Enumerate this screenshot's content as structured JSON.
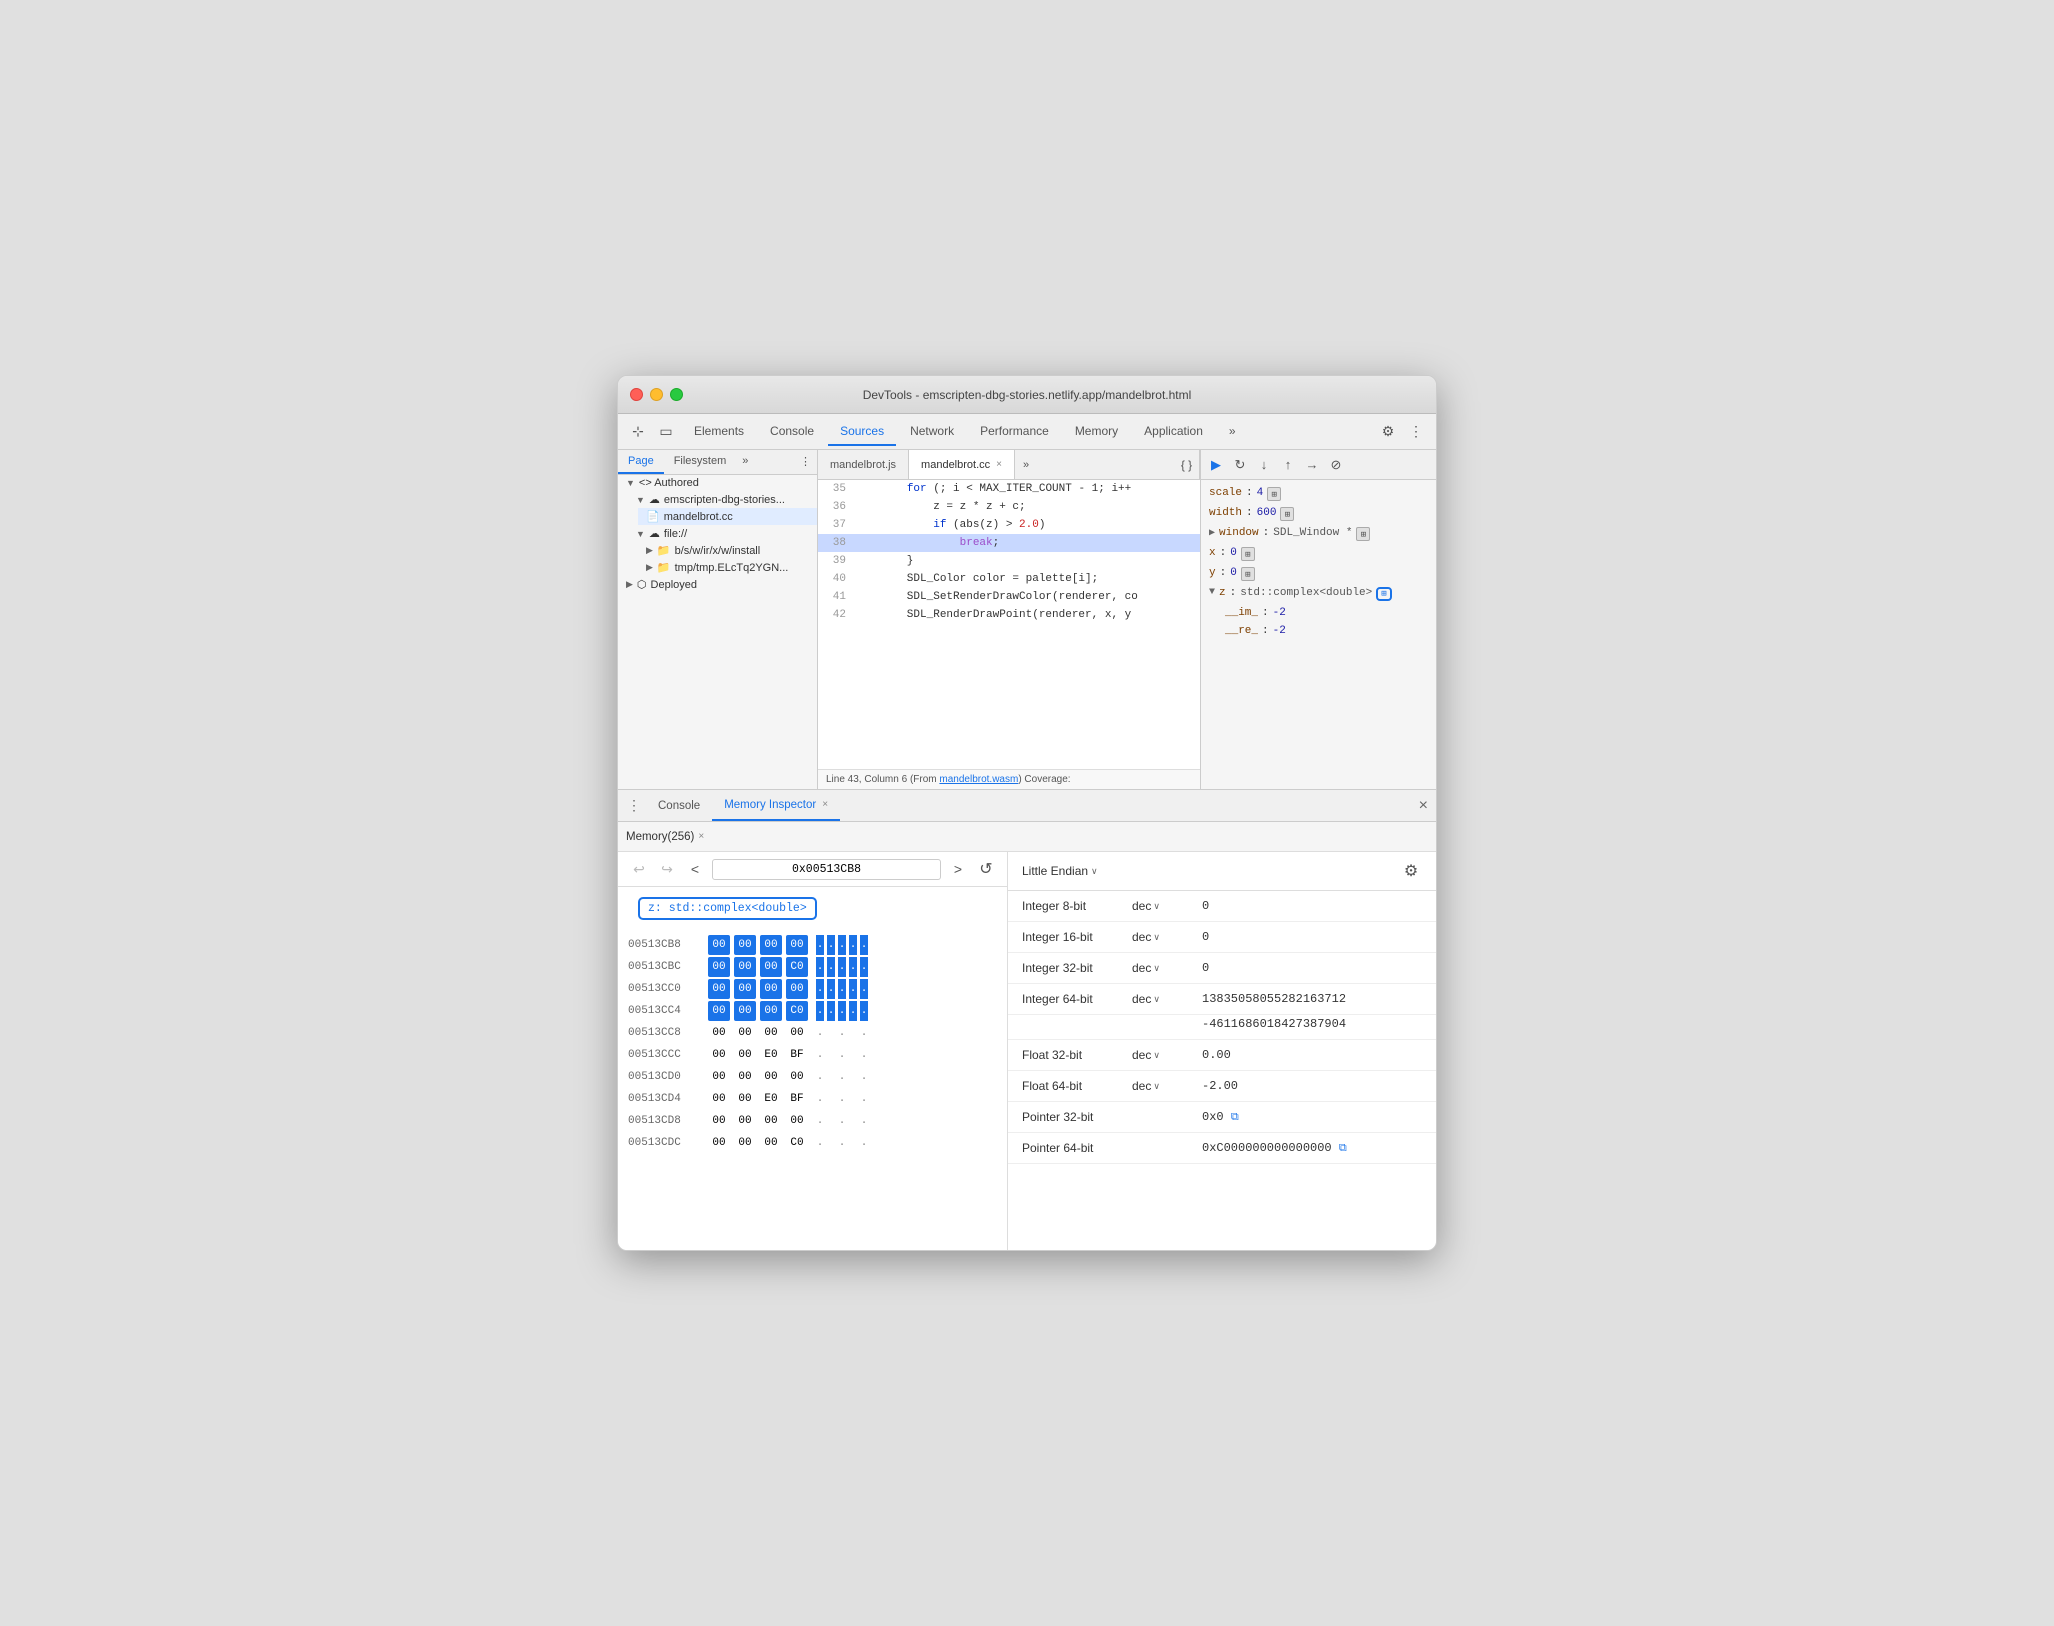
{
  "window": {
    "title": "DevTools - emscripten-dbg-stories.netlify.app/mandelbrot.html"
  },
  "toolbar": {
    "tabs": [
      {
        "label": "Elements",
        "active": false
      },
      {
        "label": "Console",
        "active": false
      },
      {
        "label": "Sources",
        "active": true
      },
      {
        "label": "Network",
        "active": false
      },
      {
        "label": "Performance",
        "active": false
      },
      {
        "label": "Memory",
        "active": false
      },
      {
        "label": "Application",
        "active": false
      },
      {
        "label": "»",
        "active": false
      }
    ]
  },
  "left_panel": {
    "tabs": [
      "Page",
      "Filesystem",
      "»"
    ],
    "tree": [
      {
        "label": "Authored",
        "level": 0,
        "type": "group"
      },
      {
        "label": "emscripten-dbg-stories...",
        "level": 1,
        "type": "cloud"
      },
      {
        "label": "mandelbrot.cc",
        "level": 2,
        "type": "file",
        "selected": true
      },
      {
        "label": "file://",
        "level": 1,
        "type": "cloud"
      },
      {
        "label": "b/s/w/ir/x/w/install",
        "level": 2,
        "type": "folder"
      },
      {
        "label": "tmp/tmp.ELcTq2YGN...",
        "level": 2,
        "type": "folder"
      },
      {
        "label": "Deployed",
        "level": 0,
        "type": "group"
      }
    ]
  },
  "code_panel": {
    "tabs": [
      "mandelbrot.js",
      "mandelbrot.cc"
    ],
    "active_tab": "mandelbrot.cc",
    "lines": [
      {
        "num": 35,
        "content": "        for (; i < MAX_ITER_COUNT - 1; i++",
        "highlighted": false
      },
      {
        "num": 36,
        "content": "            z = z * z + c;",
        "highlighted": false
      },
      {
        "num": 37,
        "content": "            if (abs(z) > 2.0)",
        "highlighted": false
      },
      {
        "num": 38,
        "content": "                break;",
        "highlighted": true
      },
      {
        "num": 39,
        "content": "        }",
        "highlighted": false
      },
      {
        "num": 40,
        "content": "        SDL_Color color = palette[i];",
        "highlighted": false
      },
      {
        "num": 41,
        "content": "        SDL_SetRenderDrawColor(renderer, co",
        "highlighted": false
      },
      {
        "num": 42,
        "content": "        SDL_RenderDrawPoint(renderer, x, y",
        "highlighted": false
      }
    ],
    "status": "Line 43, Column 6 (From mandelbrot.wasm) Coverage:"
  },
  "right_panel": {
    "scope_items": [
      {
        "key": "scale",
        "value": "4",
        "chip": true
      },
      {
        "key": "width",
        "value": "600",
        "chip": true
      },
      {
        "key": "window",
        "value": "SDL_Window *",
        "chip": true,
        "expandable": true
      },
      {
        "key": "x",
        "value": "0",
        "chip": true
      },
      {
        "key": "y",
        "value": "0",
        "chip": true
      },
      {
        "key": "z",
        "value": "std::complex<double>",
        "chip": true,
        "expandable": true,
        "highlighted": true
      },
      {
        "key": "__im_",
        "value": "-2",
        "indent": true
      },
      {
        "key": "__re_",
        "value": "-2",
        "indent": true
      }
    ]
  },
  "bottom_panel": {
    "tabs": [
      "Console",
      "Memory Inspector"
    ],
    "active_tab": "Memory Inspector",
    "memory_tabs": [
      "Memory(256)"
    ],
    "active_memory_tab": "Memory(256)"
  },
  "memory_viewer": {
    "address": "0x00513CB8",
    "variable_label": "z: std::complex<double>",
    "rows": [
      {
        "addr": "00513CB8",
        "bytes": [
          "00",
          "00",
          "00",
          "00"
        ],
        "ascii": [
          ".",
          ".",
          ".",
          ".",
          "."
        ],
        "highlighted": [
          true,
          true,
          true,
          true
        ]
      },
      {
        "addr": "00513CBC",
        "bytes": [
          "00",
          "00",
          "00",
          "C0"
        ],
        "ascii": [
          ".",
          ".",
          ".",
          ".",
          "."
        ],
        "highlighted": [
          true,
          true,
          true,
          true
        ]
      },
      {
        "addr": "00513CC0",
        "bytes": [
          "00",
          "00",
          "00",
          "00"
        ],
        "ascii": [
          ".",
          ".",
          ".",
          ".",
          "."
        ],
        "highlighted": [
          true,
          true,
          true,
          true
        ]
      },
      {
        "addr": "00513CC4",
        "bytes": [
          "00",
          "00",
          "00",
          "C0"
        ],
        "ascii": [
          ".",
          ".",
          ".",
          ".",
          "."
        ],
        "highlighted": [
          true,
          true,
          true,
          true
        ]
      },
      {
        "addr": "00513CC8",
        "bytes": [
          "00",
          "00",
          "00",
          "00"
        ],
        "ascii": [
          ".",
          ".",
          " ",
          ".",
          " "
        ],
        "highlighted": [
          false,
          false,
          false,
          false
        ]
      },
      {
        "addr": "00513CCC",
        "bytes": [
          "00",
          "00",
          "E0",
          "BF"
        ],
        "ascii": [
          ".",
          ".",
          " ",
          ".",
          " "
        ],
        "highlighted": [
          false,
          false,
          false,
          false
        ]
      },
      {
        "addr": "00513CD0",
        "bytes": [
          "00",
          "00",
          "00",
          "00"
        ],
        "ascii": [
          ".",
          ".",
          " ",
          ".",
          " "
        ],
        "highlighted": [
          false,
          false,
          false,
          false
        ]
      },
      {
        "addr": "00513CD4",
        "bytes": [
          "00",
          "00",
          "E0",
          "BF"
        ],
        "ascii": [
          ".",
          ".",
          " ",
          ".",
          " "
        ],
        "highlighted": [
          false,
          false,
          false,
          false
        ]
      },
      {
        "addr": "00513CD8",
        "bytes": [
          "00",
          "00",
          "00",
          "00"
        ],
        "ascii": [
          ".",
          ".",
          " ",
          ".",
          " "
        ],
        "highlighted": [
          false,
          false,
          false,
          false
        ]
      },
      {
        "addr": "00513CDC",
        "bytes": [
          "00",
          "00",
          "00",
          "C0"
        ],
        "ascii": [
          ".",
          ".",
          " ",
          ".",
          " "
        ],
        "highlighted": [
          false,
          false,
          false,
          false
        ]
      }
    ]
  },
  "memory_inspector": {
    "endian": "Little Endian",
    "rows": [
      {
        "label": "Integer 8-bit",
        "format": "dec",
        "value": "0"
      },
      {
        "label": "Integer 16-bit",
        "format": "dec",
        "value": "0"
      },
      {
        "label": "Integer 32-bit",
        "format": "dec",
        "value": "0"
      },
      {
        "label": "Integer 64-bit",
        "format": "dec",
        "value": "13835058055282163712",
        "extra": "-4611686018427387904"
      },
      {
        "label": "Float 32-bit",
        "format": "dec",
        "value": "0.00"
      },
      {
        "label": "Float 64-bit",
        "format": "dec",
        "value": "-2.00"
      },
      {
        "label": "Pointer 32-bit",
        "format": null,
        "value": "0x0",
        "link": true
      },
      {
        "label": "Pointer 64-bit",
        "format": null,
        "value": "0xC000000000000000",
        "link": true
      }
    ]
  }
}
